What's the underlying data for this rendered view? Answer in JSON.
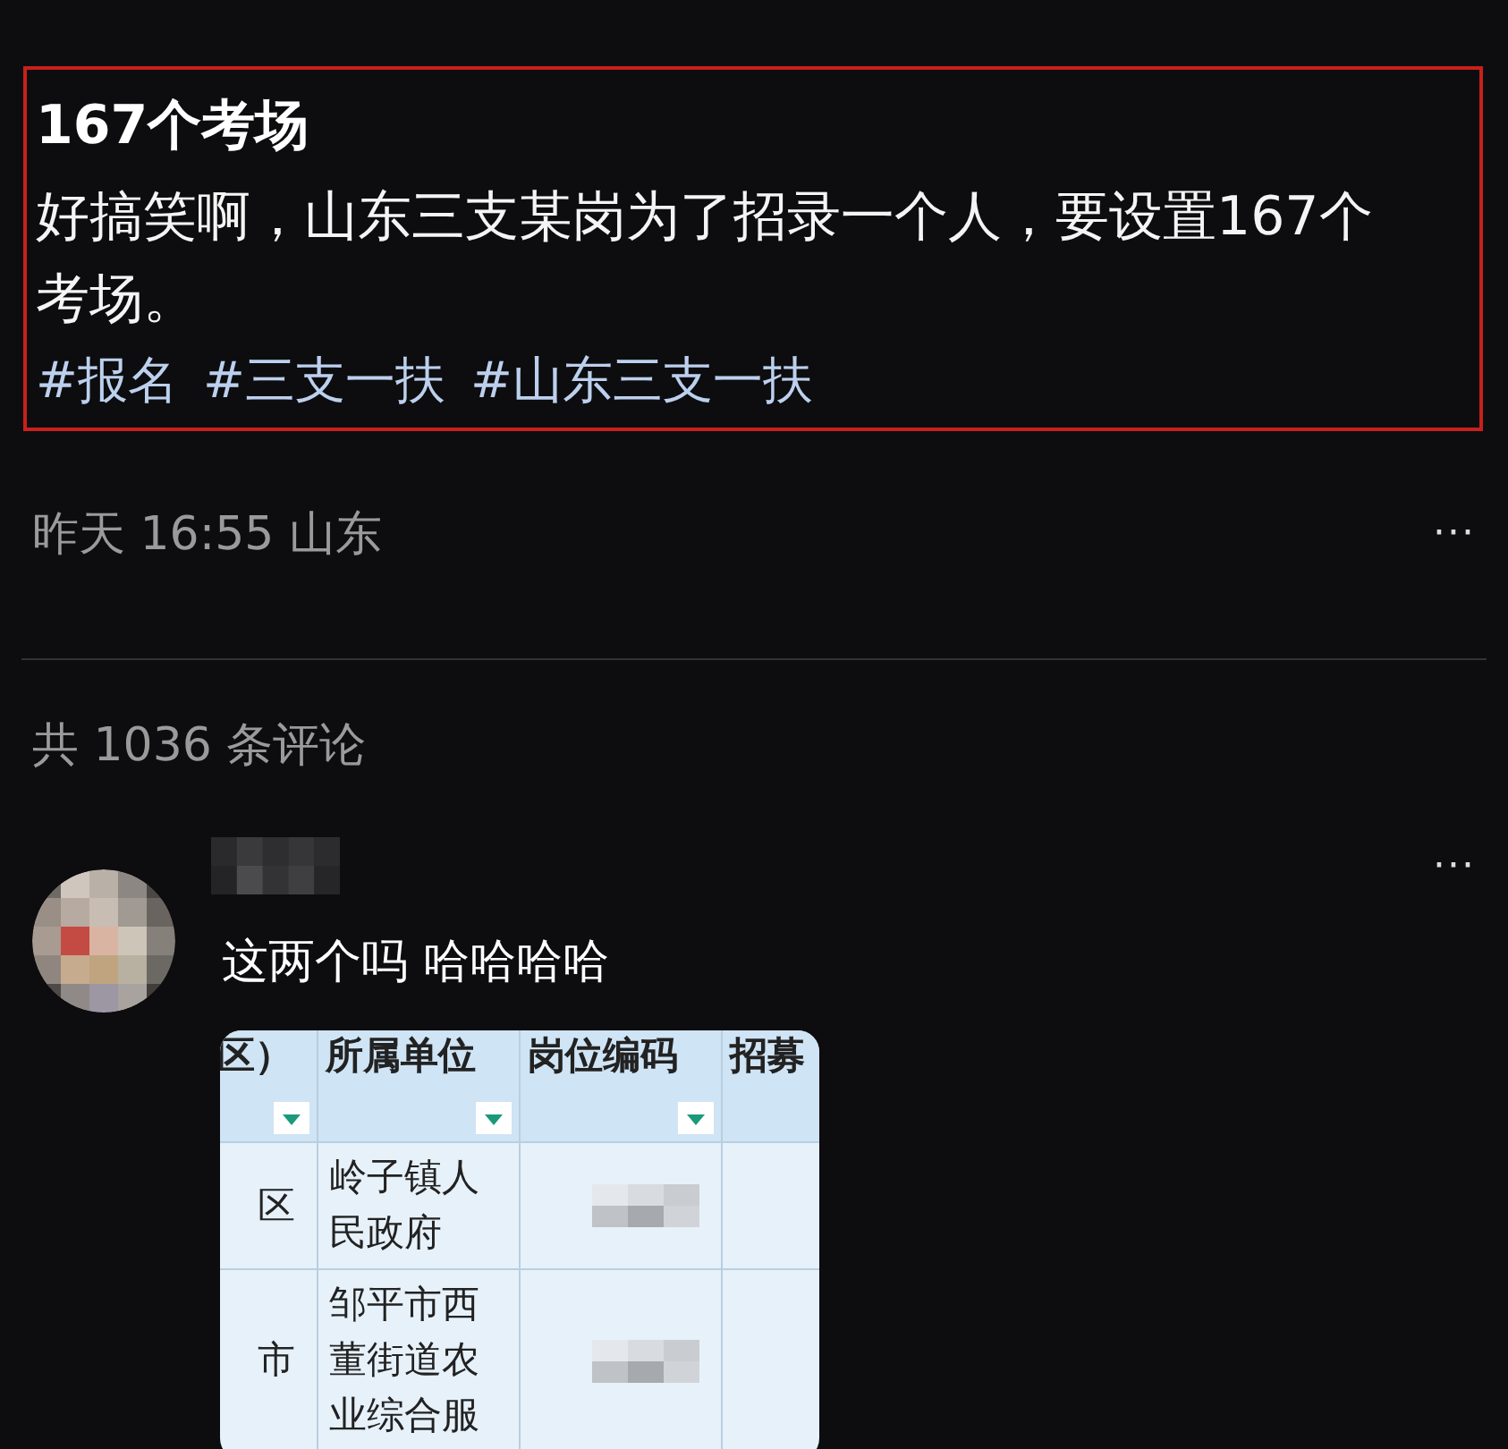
{
  "post": {
    "highlighted": true,
    "title": "167个考场",
    "body": "好搞笑啊，山东三支某岗为了招录一个人，要设置167个考场。",
    "hashtags": [
      "#报名",
      "#三支一扶",
      "#山东三支一扶"
    ],
    "meta": "昨天 16:55 山东",
    "more": "···"
  },
  "comments_count": "共 1036 条评论",
  "comments": [
    {
      "text": "这两个吗 哈哈哈哈",
      "more": "···",
      "attachment": {
        "columns": [
          {
            "label": "区）",
            "filter": true
          },
          {
            "label": "所属单位",
            "filter": true
          },
          {
            "label": "岗位编码",
            "filter": true
          },
          {
            "label": "招募",
            "filter": false
          }
        ],
        "rows": [
          [
            "区",
            "岭子镇人民政府",
            "",
            ""
          ],
          [
            "市",
            "邹平市西董街道农业综合服",
            "",
            ""
          ]
        ]
      }
    }
  ]
}
